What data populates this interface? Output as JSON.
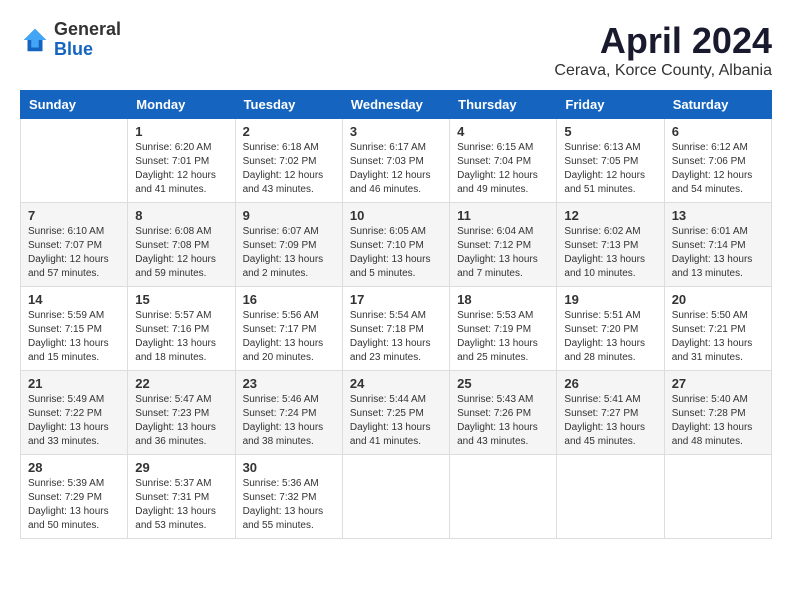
{
  "header": {
    "logo": {
      "general": "General",
      "blue": "Blue"
    },
    "title": "April 2024",
    "location": "Cerava, Korce County, Albania"
  },
  "days_of_week": [
    "Sunday",
    "Monday",
    "Tuesday",
    "Wednesday",
    "Thursday",
    "Friday",
    "Saturday"
  ],
  "weeks": [
    [
      {
        "day": "",
        "info": ""
      },
      {
        "day": "1",
        "info": "Sunrise: 6:20 AM\nSunset: 7:01 PM\nDaylight: 12 hours\nand 41 minutes."
      },
      {
        "day": "2",
        "info": "Sunrise: 6:18 AM\nSunset: 7:02 PM\nDaylight: 12 hours\nand 43 minutes."
      },
      {
        "day": "3",
        "info": "Sunrise: 6:17 AM\nSunset: 7:03 PM\nDaylight: 12 hours\nand 46 minutes."
      },
      {
        "day": "4",
        "info": "Sunrise: 6:15 AM\nSunset: 7:04 PM\nDaylight: 12 hours\nand 49 minutes."
      },
      {
        "day": "5",
        "info": "Sunrise: 6:13 AM\nSunset: 7:05 PM\nDaylight: 12 hours\nand 51 minutes."
      },
      {
        "day": "6",
        "info": "Sunrise: 6:12 AM\nSunset: 7:06 PM\nDaylight: 12 hours\nand 54 minutes."
      }
    ],
    [
      {
        "day": "7",
        "info": "Sunrise: 6:10 AM\nSunset: 7:07 PM\nDaylight: 12 hours\nand 57 minutes."
      },
      {
        "day": "8",
        "info": "Sunrise: 6:08 AM\nSunset: 7:08 PM\nDaylight: 12 hours\nand 59 minutes."
      },
      {
        "day": "9",
        "info": "Sunrise: 6:07 AM\nSunset: 7:09 PM\nDaylight: 13 hours\nand 2 minutes."
      },
      {
        "day": "10",
        "info": "Sunrise: 6:05 AM\nSunset: 7:10 PM\nDaylight: 13 hours\nand 5 minutes."
      },
      {
        "day": "11",
        "info": "Sunrise: 6:04 AM\nSunset: 7:12 PM\nDaylight: 13 hours\nand 7 minutes."
      },
      {
        "day": "12",
        "info": "Sunrise: 6:02 AM\nSunset: 7:13 PM\nDaylight: 13 hours\nand 10 minutes."
      },
      {
        "day": "13",
        "info": "Sunrise: 6:01 AM\nSunset: 7:14 PM\nDaylight: 13 hours\nand 13 minutes."
      }
    ],
    [
      {
        "day": "14",
        "info": "Sunrise: 5:59 AM\nSunset: 7:15 PM\nDaylight: 13 hours\nand 15 minutes."
      },
      {
        "day": "15",
        "info": "Sunrise: 5:57 AM\nSunset: 7:16 PM\nDaylight: 13 hours\nand 18 minutes."
      },
      {
        "day": "16",
        "info": "Sunrise: 5:56 AM\nSunset: 7:17 PM\nDaylight: 13 hours\nand 20 minutes."
      },
      {
        "day": "17",
        "info": "Sunrise: 5:54 AM\nSunset: 7:18 PM\nDaylight: 13 hours\nand 23 minutes."
      },
      {
        "day": "18",
        "info": "Sunrise: 5:53 AM\nSunset: 7:19 PM\nDaylight: 13 hours\nand 25 minutes."
      },
      {
        "day": "19",
        "info": "Sunrise: 5:51 AM\nSunset: 7:20 PM\nDaylight: 13 hours\nand 28 minutes."
      },
      {
        "day": "20",
        "info": "Sunrise: 5:50 AM\nSunset: 7:21 PM\nDaylight: 13 hours\nand 31 minutes."
      }
    ],
    [
      {
        "day": "21",
        "info": "Sunrise: 5:49 AM\nSunset: 7:22 PM\nDaylight: 13 hours\nand 33 minutes."
      },
      {
        "day": "22",
        "info": "Sunrise: 5:47 AM\nSunset: 7:23 PM\nDaylight: 13 hours\nand 36 minutes."
      },
      {
        "day": "23",
        "info": "Sunrise: 5:46 AM\nSunset: 7:24 PM\nDaylight: 13 hours\nand 38 minutes."
      },
      {
        "day": "24",
        "info": "Sunrise: 5:44 AM\nSunset: 7:25 PM\nDaylight: 13 hours\nand 41 minutes."
      },
      {
        "day": "25",
        "info": "Sunrise: 5:43 AM\nSunset: 7:26 PM\nDaylight: 13 hours\nand 43 minutes."
      },
      {
        "day": "26",
        "info": "Sunrise: 5:41 AM\nSunset: 7:27 PM\nDaylight: 13 hours\nand 45 minutes."
      },
      {
        "day": "27",
        "info": "Sunrise: 5:40 AM\nSunset: 7:28 PM\nDaylight: 13 hours\nand 48 minutes."
      }
    ],
    [
      {
        "day": "28",
        "info": "Sunrise: 5:39 AM\nSunset: 7:29 PM\nDaylight: 13 hours\nand 50 minutes."
      },
      {
        "day": "29",
        "info": "Sunrise: 5:37 AM\nSunset: 7:31 PM\nDaylight: 13 hours\nand 53 minutes."
      },
      {
        "day": "30",
        "info": "Sunrise: 5:36 AM\nSunset: 7:32 PM\nDaylight: 13 hours\nand 55 minutes."
      },
      {
        "day": "",
        "info": ""
      },
      {
        "day": "",
        "info": ""
      },
      {
        "day": "",
        "info": ""
      },
      {
        "day": "",
        "info": ""
      }
    ]
  ]
}
